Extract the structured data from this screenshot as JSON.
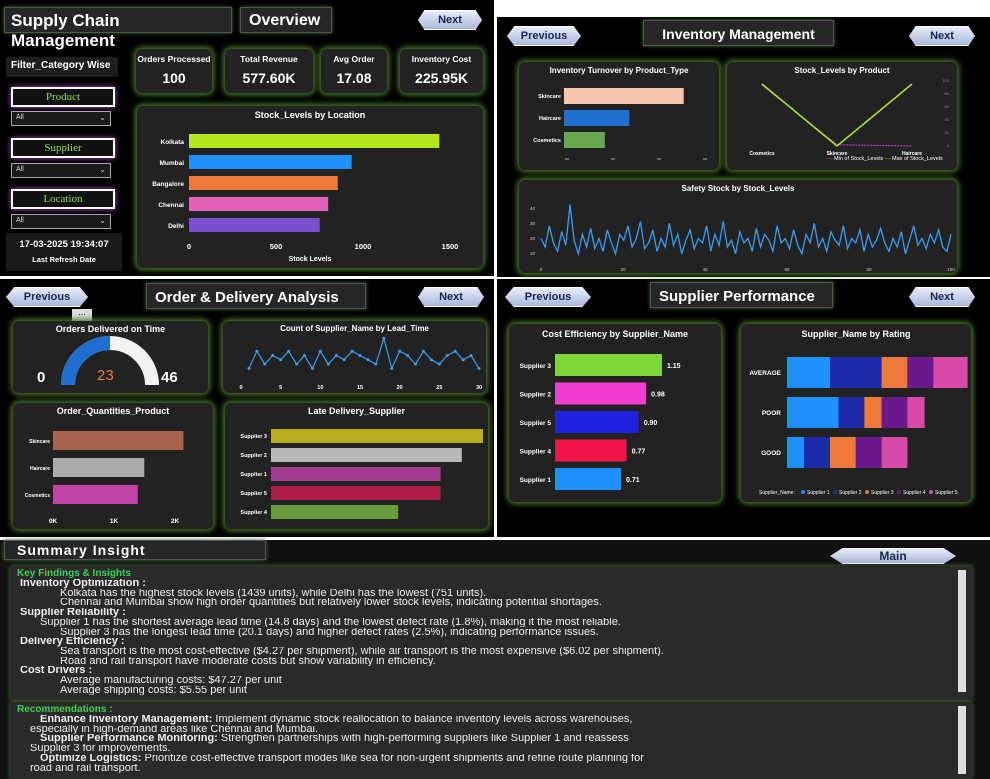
{
  "overview": {
    "app_title": "Supply Chain Management",
    "page_title": "Overview",
    "next_label": "Next",
    "filter_title": "Filter_Category Wise",
    "slicers": [
      {
        "label": "Product",
        "value": "All"
      },
      {
        "label": "Supplier",
        "value": "All"
      },
      {
        "label": "Location",
        "value": "All"
      }
    ],
    "refresh_time": "17-03-2025 19:34:07",
    "refresh_label": "Last Refresh Date",
    "kpis": [
      {
        "label": "Orders Processed",
        "value": "100"
      },
      {
        "label": "Total Revenue",
        "value": "577.60K"
      },
      {
        "label": "Avg Order",
        "value": "17.08"
      },
      {
        "label": "Inventory Cost",
        "value": "225.95K"
      }
    ]
  },
  "inventory": {
    "title": "Inventory Management",
    "prev_label": "Previous",
    "next_label": "Next",
    "legend_min": "Min of Stock_Levels",
    "legend_max": "Max of Stock_Levels"
  },
  "orders": {
    "title": "Order & Delivery Analysis",
    "prev_label": "Previous",
    "next_label": "Next",
    "more": "...",
    "gauge_title": "Orders Delivered on Time",
    "gauge_min": "0",
    "gauge_value": "23",
    "gauge_max": "46",
    "gauge_fraction": 0.5
  },
  "supplier": {
    "title": "Supplier Performance",
    "prev_label": "Previous",
    "next_label": "Next"
  },
  "summary": {
    "title": "Summary Insight",
    "main_label": "Main",
    "key_heading": "Key Findings & Insights",
    "lines": [
      {
        "t": "Inventory Optimization :",
        "b": true,
        "i": 0
      },
      {
        "t": "Kolkata has the highest stock levels (1439 units), while Delhi has the lowest (751 units).",
        "i": 2
      },
      {
        "t": "Chennai and Mumbai show high order quantities but relatively lower stock levels, indicating potential shortages.",
        "i": 2
      },
      {
        "t": "Supplier Reliability :",
        "b": true,
        "i": 0
      },
      {
        "t": "Supplier 1 has the shortest average lead time (14.8 days) and the lowest defect rate (1.8%), making it the most reliable.",
        "i": 1
      },
      {
        "t": "Supplier 3 has the longest lead time (20.1 days) and higher defect rates (2.5%), indicating performance issues.",
        "i": 2
      },
      {
        "t": "Delivery Efficiency :",
        "b": true,
        "i": 0
      },
      {
        "t": "Sea transport is the most cost-effective ($4.27 per shipment), while air transport is the most expensive ($6.02 per shipment).",
        "i": 2
      },
      {
        "t": "Road and rail transport have moderate costs but show variability in efficiency.",
        "i": 2
      },
      {
        "t": "Cost Drivers :",
        "b": true,
        "i": 0
      },
      {
        "t": "Average manufacturing costs: $47.27 per unit",
        "i": 2
      },
      {
        "t": "Average shipping costs: $5.55 per unit",
        "i": 2
      }
    ],
    "rec_heading": "Recommendations :",
    "recs": [
      {
        "h": "Enhance Inventory Management:",
        "t": " Implement dynamic stock reallocation to balance inventory levels across warehouses,"
      },
      {
        "h": "",
        "t": "especially in high-demand areas like Chennai and Mumbai."
      },
      {
        "h": "Supplier Performance Monitoring:",
        "t": " Strengthen partnerships with high-performing suppliers like Supplier 1 and reassess"
      },
      {
        "h": "",
        "t": "Supplier 3 for improvements."
      },
      {
        "h": "Optimize Logistics:",
        "t": " Prioritize cost-effective transport modes like sea for non-urgent shipments and refine route planning for"
      },
      {
        "h": "",
        "t": "road and rail transport."
      }
    ]
  },
  "chart_data": [
    {
      "id": "stock-by-location",
      "type": "bar",
      "title": "Stock_Levels by Location",
      "xlabel": "Stock Levels",
      "categories": [
        "Kolkata",
        "Mumbai",
        "Bangalore",
        "Chennai",
        "Delhi"
      ],
      "values": [
        1439,
        935,
        855,
        800,
        751
      ],
      "colors": [
        "#b5e61d",
        "#1e90ff",
        "#ee7b3a",
        "#e060b8",
        "#7b50d0"
      ],
      "xticks": [
        "0",
        "500",
        "1000",
        "1500"
      ],
      "xlim": [
        0,
        1500
      ]
    },
    {
      "id": "turnover-by-type",
      "type": "bar",
      "title": "Inventory Turnover by Product_Type",
      "categories": [
        "Skincare",
        "Haircare",
        "Cosmetics"
      ],
      "values": [
        0.88,
        0.48,
        0.3
      ],
      "colors": [
        "#f6c6ae",
        "#1e6fd0",
        "#6aa84f"
      ]
    },
    {
      "id": "stock-by-product",
      "type": "line",
      "title": "Stock_Levels by Product",
      "categories": [
        "Cosmetics",
        "Skincare",
        "Haircare"
      ],
      "series": [
        {
          "name": "Min of Stock_Levels",
          "values": [
            98,
            2,
            0
          ]
        },
        {
          "name": "Max of Stock_Levels",
          "values": [
            100,
            0,
            100
          ]
        }
      ],
      "colors": [
        "#d43fd2",
        "#a6e22e"
      ],
      "yticks": [
        "100",
        "80",
        "60",
        "40",
        "20",
        "0"
      ]
    },
    {
      "id": "safety-stock",
      "type": "line",
      "title": "Safety Stock by Stock_Levels",
      "values": [
        30,
        20,
        45,
        25,
        15,
        38,
        22,
        70,
        28,
        12,
        35,
        20,
        42,
        18,
        30,
        15,
        40,
        25,
        12,
        35,
        28,
        45,
        20,
        30,
        50,
        18,
        25,
        40,
        15,
        30,
        20,
        48,
        22,
        35,
        12,
        28,
        40,
        18,
        30,
        25,
        45,
        15,
        35,
        22,
        50,
        20,
        28,
        12,
        38,
        25,
        30,
        15,
        42,
        20,
        35,
        28,
        15,
        45,
        25,
        30,
        18,
        40,
        22,
        12,
        35,
        25,
        48,
        20,
        30,
        15,
        38,
        28,
        22,
        45,
        18,
        30,
        25,
        40,
        15,
        35,
        20,
        28,
        42,
        25,
        15,
        30,
        20,
        38,
        12,
        28,
        45,
        22,
        30,
        18,
        35,
        25,
        40,
        20,
        15,
        35
      ],
      "yticks": [
        "40",
        "30",
        "20",
        "10"
      ],
      "xticks": [
        "0",
        "20",
        "40",
        "60",
        "80",
        "100"
      ],
      "color": "#3a9cf0"
    },
    {
      "id": "supplier-lead-time",
      "type": "line",
      "title": "Count of Supplier_Name by Lead_Time",
      "x": [
        1,
        2,
        3,
        4,
        5,
        6,
        7,
        8,
        9,
        10,
        11,
        12,
        13,
        14,
        15,
        16,
        17,
        18,
        19,
        20,
        21,
        22,
        23,
        24,
        25,
        26,
        27,
        28,
        29,
        30
      ],
      "values": [
        2,
        6,
        3,
        5,
        4,
        6,
        3,
        5,
        2,
        6,
        3,
        5,
        4,
        6,
        5,
        4,
        3,
        9,
        2,
        6,
        5,
        3,
        6,
        4,
        3,
        5,
        6,
        4,
        5,
        2
      ],
      "xticks": [
        "0",
        "5",
        "10",
        "15",
        "20",
        "25",
        "30"
      ],
      "color": "#3a9cf0"
    },
    {
      "id": "order-qty-product",
      "type": "bar",
      "title": "Order_Quantities_Product",
      "categories": [
        "Skincare",
        "Haircare",
        "Cosmetics"
      ],
      "values": [
        2000,
        1400,
        1300
      ],
      "colors": [
        "#a8634a",
        "#aaaaaa",
        "#c044a8"
      ],
      "xticks": [
        "0K",
        "1K",
        "2K"
      ],
      "xlim": [
        0,
        2300
      ]
    },
    {
      "id": "late-delivery-supplier",
      "type": "bar",
      "title": "Late Delivery_Supplier",
      "categories": [
        "Supplier 3",
        "Supplier 2",
        "Supplier 1",
        "Supplier 5",
        "Supplier 4"
      ],
      "values": [
        100,
        90,
        80,
        80,
        60
      ],
      "colors": [
        "#b6ae1e",
        "#b8b8b8",
        "#a13c90",
        "#b01d48",
        "#6a9a3a"
      ]
    },
    {
      "id": "cost-efficiency",
      "type": "bar",
      "title": "Cost Efficiency by Supplier_Name",
      "categories": [
        "Supplier 3",
        "Supplier 2",
        "Supplier 5",
        "Supplier 4",
        "Supplier 1"
      ],
      "values": [
        1.15,
        0.98,
        0.9,
        0.77,
        0.71
      ],
      "labels": [
        "1.15",
        "0.98",
        "0.90",
        "0.77",
        "0.71"
      ],
      "colors": [
        "#7dd63a",
        "#f03ccf",
        "#2020e0",
        "#f01448",
        "#1e90ff"
      ]
    },
    {
      "id": "supplier-by-rating",
      "type": "bar",
      "title": "Supplier_Name by Rating",
      "categories": [
        "AVERAGE",
        "POOR",
        "GOOD"
      ],
      "series": [
        {
          "name": "Supplier 1",
          "values": [
            5,
            6,
            2
          ]
        },
        {
          "name": "Supplier 2",
          "values": [
            6,
            3,
            3
          ]
        },
        {
          "name": "Supplier 3",
          "values": [
            3,
            2,
            3
          ]
        },
        {
          "name": "Supplier 4",
          "values": [
            3,
            3,
            3
          ]
        },
        {
          "name": "Supplier 5",
          "values": [
            4,
            2,
            3
          ]
        }
      ],
      "legend_title": "Supplier_Name",
      "colors": [
        "#1e90ff",
        "#1a2aa8",
        "#ee7b3a",
        "#6a1a8a",
        "#d84aa8"
      ]
    }
  ]
}
